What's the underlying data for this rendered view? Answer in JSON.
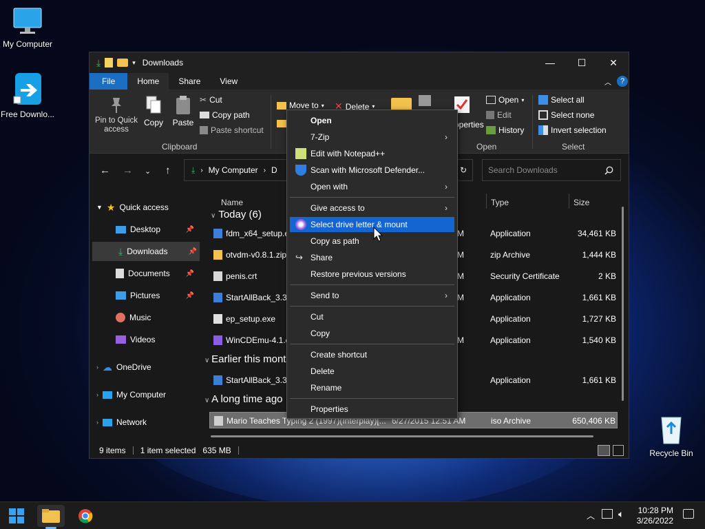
{
  "desktop": {
    "my_computer": "My Computer",
    "free_download": "Free Downlo...",
    "recycle_bin": "Recycle Bin"
  },
  "window": {
    "title": "Downloads"
  },
  "ribbon_tabs": [
    "File",
    "Home",
    "Share",
    "View"
  ],
  "ribbon": {
    "pin": "Pin to Quick access",
    "copy": "Copy",
    "paste": "Paste",
    "cut": "Cut",
    "copy_path": "Copy path",
    "paste_shortcut": "Paste shortcut",
    "move_to": "Move to",
    "delete": "Delete",
    "properties": "operties",
    "open": "Open",
    "edit": "Edit",
    "history": "History",
    "select_all": "Select all",
    "select_none": "Select none",
    "invert_selection": "Invert selection",
    "groups": {
      "clipboard": "Clipboard",
      "open": "Open",
      "select": "Select"
    }
  },
  "address": {
    "path1": "My Computer",
    "path2": "D",
    "search_placeholder": "Search Downloads"
  },
  "sidebar": [
    {
      "label": "Quick access"
    },
    {
      "label": "Desktop"
    },
    {
      "label": "Downloads"
    },
    {
      "label": "Documents"
    },
    {
      "label": "Pictures"
    },
    {
      "label": "Music"
    },
    {
      "label": "Videos"
    },
    {
      "label": "OneDrive"
    },
    {
      "label": "My Computer"
    },
    {
      "label": "Network"
    }
  ],
  "columns": {
    "name": "Name",
    "type": "Type",
    "size": "Size"
  },
  "groups": {
    "today": "Today (6)",
    "earlier": "Earlier this mont",
    "long_ago": "A long time ago"
  },
  "files": [
    {
      "name": "fdm_x64_setup.e",
      "date": "M",
      "type": "Application",
      "size": "34,461 KB"
    },
    {
      "name": "otvdm-v0.8.1.zip",
      "date": "M",
      "type": "zip Archive",
      "size": "1,444 KB"
    },
    {
      "name": "penis.crt",
      "date": "M",
      "type": "Security Certificate",
      "size": "2 KB"
    },
    {
      "name": "StartAllBack_3.3.",
      "date": "M",
      "type": "Application",
      "size": "1,661 KB"
    },
    {
      "name": "ep_setup.exe",
      "date": "M",
      "type": "Application",
      "size": "1,727 KB"
    },
    {
      "name": "WinCDEmu-4.1.e",
      "date": "M",
      "type": "Application",
      "size": "1,540 KB"
    },
    {
      "name": "StartAllBack_3.3.",
      "date": "M",
      "type": "Application",
      "size": "1,661 KB"
    },
    {
      "name": "Mario Teaches Typing 2 (1997)(Interplay)[...",
      "date": "6/27/2015 12:51 AM",
      "type": "iso Archive",
      "size": "650,406 KB"
    }
  ],
  "status": {
    "count": "9 items",
    "selected": "1 item selected",
    "size": "635 MB"
  },
  "context_menu": [
    "Open",
    "7-Zip",
    "Edit with Notepad++",
    "Scan with Microsoft Defender...",
    "Open with",
    "Give access to",
    "Select drive letter & mount",
    "Copy as path",
    "Share",
    "Restore previous versions",
    "Send to",
    "Cut",
    "Copy",
    "Create shortcut",
    "Delete",
    "Rename",
    "Properties"
  ],
  "clock": {
    "time": "10:28 PM",
    "date": "3/26/2022"
  }
}
